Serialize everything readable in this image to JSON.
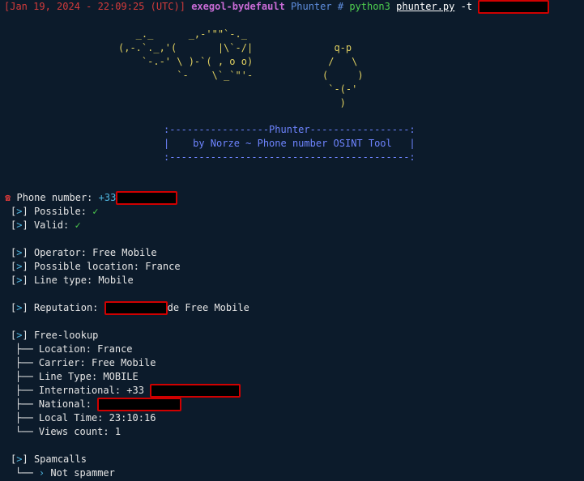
{
  "prompt": {
    "timestamp": "Jan 19, 2024 - 22:09:25 (UTC)",
    "host": "exegol-bydefault",
    "cwd": "Phunter",
    "symbol": "#",
    "cmd": "python3",
    "script": "phunter.py",
    "flag": "-t"
  },
  "ascii_left": [
    "   _._      _,-'\"\"`-._",
    "(,-.`._,'(       |\\`-/|",
    "    `-.-' \\ )-`( , o o)",
    "          `-    \\`_`\"'-"
  ],
  "ascii_right": [
    "  q-p",
    " /   \\",
    "(     )",
    " `-(-'",
    "   )"
  ],
  "banner": {
    "top": ":-----------------Phunter-----------------:",
    "middle": "|    by Norze ~ Phone number OSINT Tool   |",
    "bottom": ":-----------------------------------------:"
  },
  "phone": {
    "label": "Phone number:",
    "prefix": "+33"
  },
  "checks": [
    {
      "label": "Possible:",
      "mark": "✓"
    },
    {
      "label": "Valid:",
      "mark": "✓"
    }
  ],
  "info": [
    "Operator: Free Mobile",
    "Possible location: France",
    "Line type: Mobile"
  ],
  "reputation": {
    "label": "Reputation:",
    "suffix": "de Free Mobile"
  },
  "free_lookup": {
    "title": "Free-lookup",
    "items": [
      "Location: France",
      "Carrier: Free Mobile",
      "Line Type: MOBILE"
    ],
    "international_label": "International: +33",
    "national_label": "National:",
    "local_time": "Local Time: 23:10:16",
    "views": "Views count: 1"
  },
  "spamcalls": {
    "title": "Spamcalls",
    "result": "Not spammer"
  },
  "glyphs": {
    "bracket_open": "[",
    "bracket_chev": ">",
    "bracket_close": "]",
    "tree_mid": "├──",
    "tree_last": "└──",
    "tree_v": "│"
  }
}
